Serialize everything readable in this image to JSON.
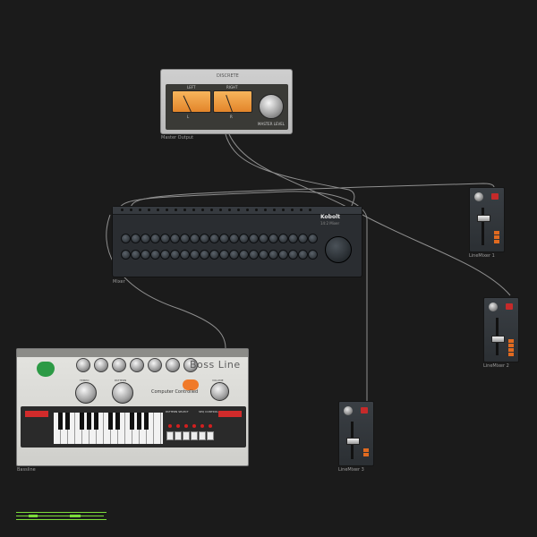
{
  "devices": {
    "master": {
      "label": "Master Output",
      "title": "DISCRETE",
      "left_meter": "LEFT",
      "right_meter": "RIGHT",
      "left_text": "L",
      "right_text": "R",
      "knob_label": "MASTER LEVEL"
    },
    "mixer": {
      "label": "Mixer",
      "brand": "Kobolt",
      "sub": "14:2 Mixer"
    },
    "line_mixers": [
      {
        "label": "LineMixer 1"
      },
      {
        "label": "LineMixer 2"
      },
      {
        "label": "LineMixer 3"
      }
    ],
    "bossline": {
      "label": "Bassline",
      "title": "Boss Line",
      "subtitle": "Computer Controlled",
      "knob_labels": [
        "WAVEFORM",
        "TUNING",
        "CUTOFF FREQ",
        "RESONANCE",
        "ENV MOD",
        "DECAY",
        "ACCENT"
      ],
      "big_knob_labels": [
        "TEMPO",
        "PATTERN",
        "VOLUME"
      ],
      "seq_labels": [
        "PATTERN SELECT",
        "SEQ CONTROL"
      ],
      "led_value": "1"
    }
  },
  "colors": {
    "background": "#1b1b1b",
    "cable": "#8f8f8f",
    "vu_orange": "#f0a24a",
    "mute_red": "#c62a2a",
    "boss_green": "#2c9a45",
    "indicator_green": "#7cdc3a"
  }
}
